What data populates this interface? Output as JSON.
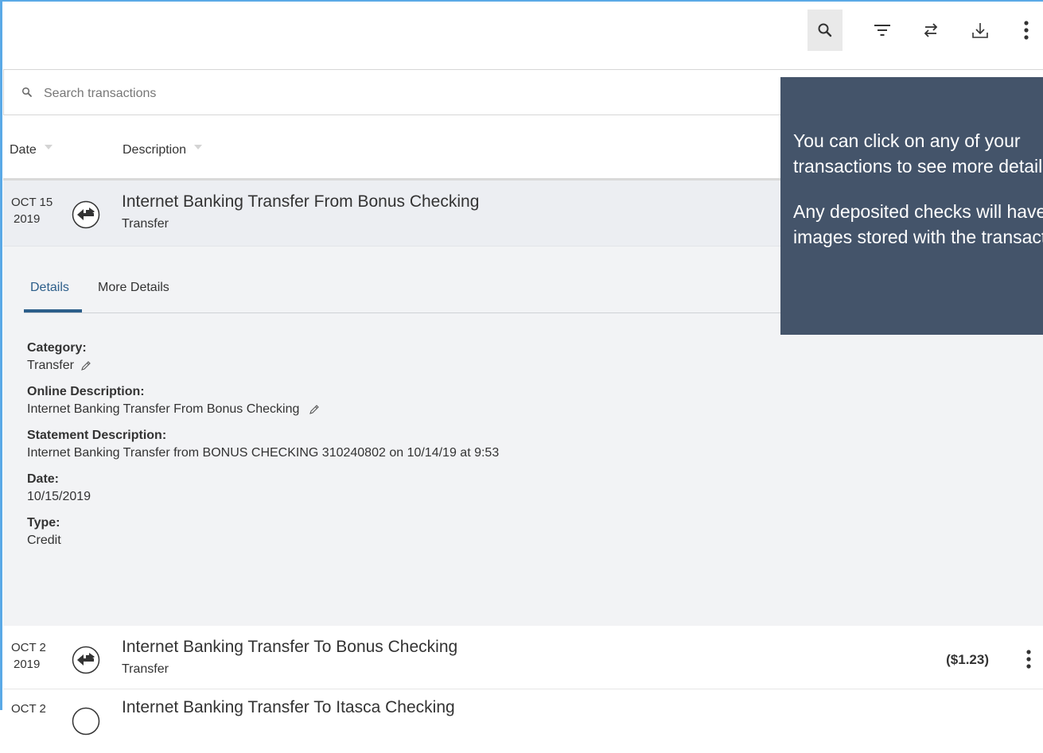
{
  "toolbar": {
    "buttons": [
      {
        "icon": "search-icon",
        "active": true
      },
      {
        "icon": "filter-icon"
      },
      {
        "icon": "transfer-arrows-icon"
      },
      {
        "icon": "download-icon"
      },
      {
        "icon": "more-vertical-icon"
      }
    ]
  },
  "search": {
    "placeholder": "Search transactions",
    "value": ""
  },
  "columns": {
    "date": "Date",
    "description": "Description"
  },
  "expanded_transaction": {
    "date_month_day": "OCT 15",
    "date_year": "2019",
    "title": "Internet Banking Transfer From Bonus Checking",
    "subtitle": "Transfer",
    "icon": "transfer-icon",
    "tabs": [
      {
        "label": "Details",
        "active": true
      },
      {
        "label": "More Details",
        "active": false
      }
    ],
    "details": {
      "category_label": "Category:",
      "category_value": "Transfer",
      "online_desc_label": "Online Description:",
      "online_desc_value": "Internet Banking Transfer From Bonus Checking",
      "statement_desc_label": "Statement Description:",
      "statement_desc_value": "Internet Banking Transfer from BONUS CHECKING 310240802 on 10/14/19 at 9:53",
      "date_label": "Date:",
      "date_value": "10/15/2019",
      "type_label": "Type:",
      "type_value": "Credit"
    }
  },
  "transactions": [
    {
      "date_month_day": "OCT 2",
      "date_year": "2019",
      "title": "Internet Banking Transfer To Bonus Checking",
      "subtitle": "Transfer",
      "amount": "($1.23)",
      "icon": "transfer-icon"
    },
    {
      "date_month_day": "OCT 2",
      "date_year": "",
      "title": "Internet Banking Transfer To Itasca Checking",
      "subtitle": "",
      "amount": "",
      "icon": "transfer-icon"
    }
  ],
  "tooltip": {
    "line1": "You can click on any of your",
    "line2": "transactions to see more details.",
    "line3": "Any deposited checks will have",
    "line4": "images stored with the transaction."
  },
  "colors": {
    "accent": "#2c5e8a",
    "tooltip_bg": "#44546a",
    "expanded_bg": "#f2f3f5",
    "frame_border": "#5aa9e6"
  }
}
